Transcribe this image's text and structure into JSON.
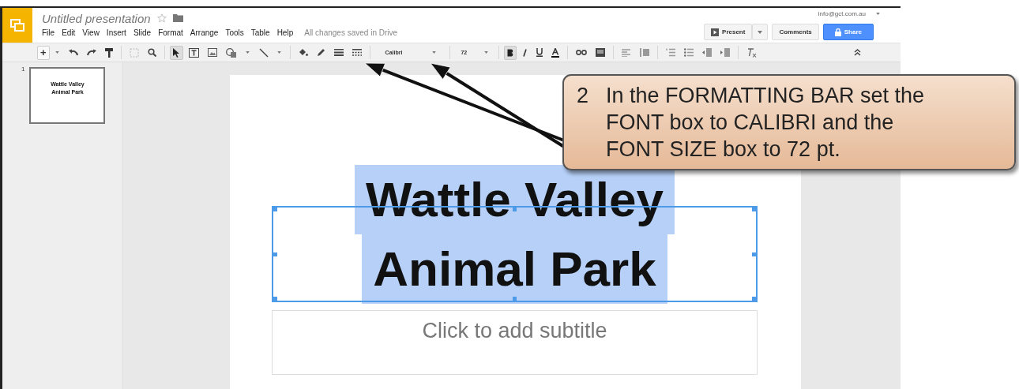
{
  "app": {
    "title": "Untitled presentation",
    "starred": false,
    "menus": [
      "File",
      "Edit",
      "View",
      "Insert",
      "Slide",
      "Format",
      "Arrange",
      "Tools",
      "Table",
      "Help"
    ],
    "save_status": "All changes saved in Drive",
    "account": "info@gct.com.au"
  },
  "buttons": {
    "present": "Present",
    "comments": "Comments",
    "share": "Share"
  },
  "toolbar": {
    "add": "+",
    "font": "Calibri",
    "font_size": "72",
    "bold": true
  },
  "filmstrip": [
    {
      "number": "1",
      "title_lines": [
        "Wattle Valley",
        "Animal Park"
      ],
      "selected": true
    }
  ],
  "slide": {
    "title_lines": [
      "Wattle Valley",
      "Animal Park"
    ],
    "title_selected": true,
    "subtitle_placeholder": "Click to add subtitle"
  },
  "callout": {
    "step": "2",
    "text": "In the FORMATTING BAR set the FONT box to CALIBRI and the FONT SIZE box to 72 pt."
  }
}
